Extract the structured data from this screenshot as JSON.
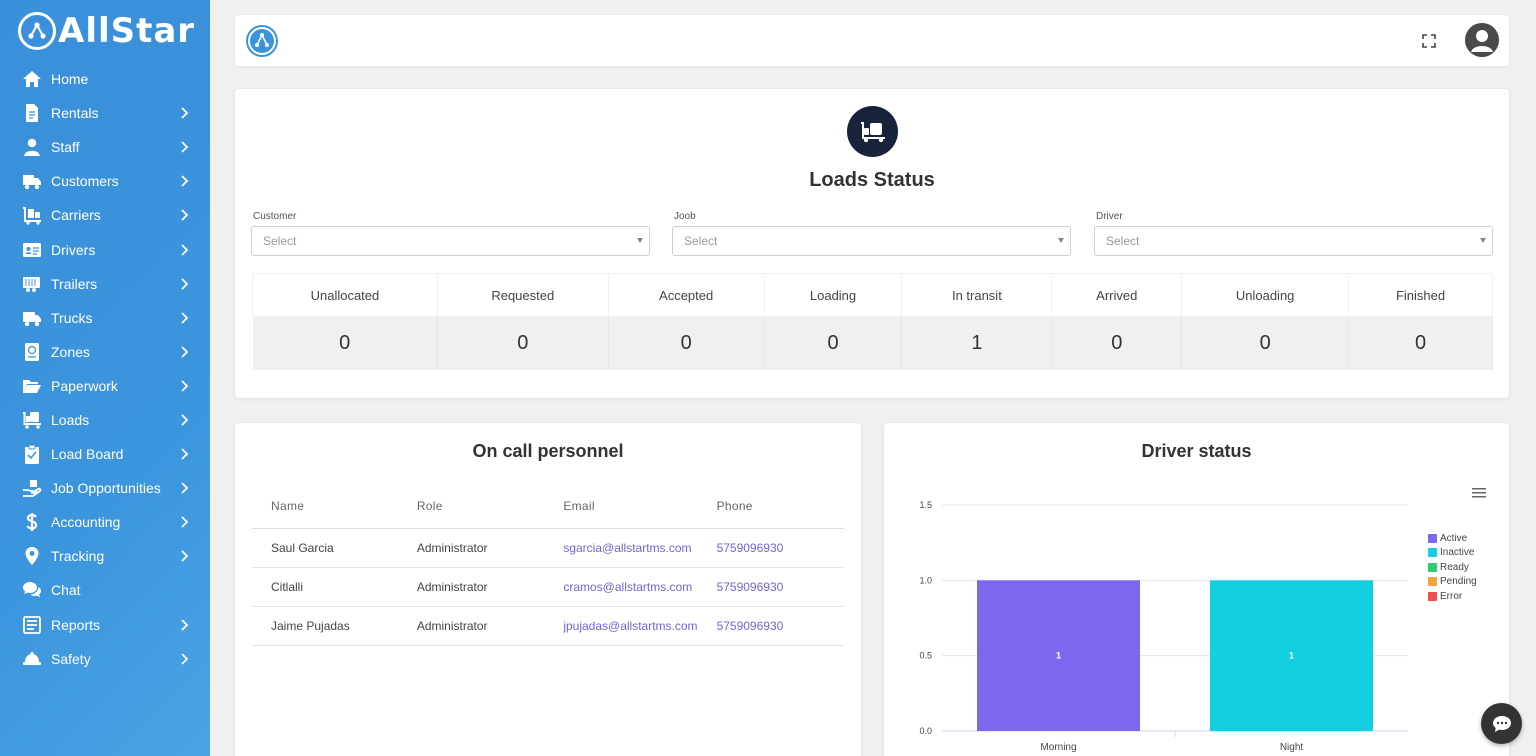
{
  "brand": {
    "name": "AllStar"
  },
  "sidebar": {
    "items": [
      {
        "label": "Home",
        "icon": "home-icon",
        "has_submenu": false
      },
      {
        "label": "Rentals",
        "icon": "file-icon",
        "has_submenu": true
      },
      {
        "label": "Staff",
        "icon": "user-icon",
        "has_submenu": true
      },
      {
        "label": "Customers",
        "icon": "truck-moving-icon",
        "has_submenu": true
      },
      {
        "label": "Carriers",
        "icon": "dolly-icon",
        "has_submenu": true
      },
      {
        "label": "Drivers",
        "icon": "id-card-icon",
        "has_submenu": true
      },
      {
        "label": "Trailers",
        "icon": "trailer-icon",
        "has_submenu": true
      },
      {
        "label": "Trucks",
        "icon": "truck-icon",
        "has_submenu": true
      },
      {
        "label": "Zones",
        "icon": "passport-icon",
        "has_submenu": true
      },
      {
        "label": "Paperwork",
        "icon": "folder-open-icon",
        "has_submenu": true
      },
      {
        "label": "Loads",
        "icon": "loads-icon",
        "has_submenu": true
      },
      {
        "label": "Load Board",
        "icon": "clipboard-icon",
        "has_submenu": true
      },
      {
        "label": "Job Opportunities",
        "icon": "hand-holding-icon",
        "has_submenu": true
      },
      {
        "label": "Accounting",
        "icon": "dollar-icon",
        "has_submenu": true
      },
      {
        "label": "Tracking",
        "icon": "map-marker-icon",
        "has_submenu": true
      },
      {
        "label": "Chat",
        "icon": "comments-icon",
        "has_submenu": false
      },
      {
        "label": "Reports",
        "icon": "list-alt-icon",
        "has_submenu": true
      },
      {
        "label": "Safety",
        "icon": "hard-hat-icon",
        "has_submenu": true
      }
    ]
  },
  "loads_status": {
    "title": "Loads Status",
    "filters": [
      {
        "label": "Customer",
        "placeholder": "Select"
      },
      {
        "label": "Joob",
        "placeholder": "Select"
      },
      {
        "label": "Driver",
        "placeholder": "Select"
      }
    ],
    "columns": [
      "Unallocated",
      "Requested",
      "Accepted",
      "Loading",
      "In transit",
      "Arrived",
      "Unloading",
      "Finished"
    ],
    "counts": [
      "0",
      "0",
      "0",
      "0",
      "1",
      "0",
      "0",
      "0"
    ]
  },
  "on_call": {
    "title": "On call personnel",
    "headers": [
      "Name",
      "Role",
      "Email",
      "Phone"
    ],
    "rows": [
      {
        "name": "Saul Garcia",
        "role": "Administrator",
        "email": "sgarcia@allstartms.com",
        "phone": "5759096930"
      },
      {
        "name": "Citlalli",
        "role": "Administrator",
        "email": "cramos@allstartms.com",
        "phone": "5759096930"
      },
      {
        "name": "Jaime Pujadas",
        "role": "Administrator",
        "email": "jpujadas@allstartms.com",
        "phone": "5759096930"
      }
    ]
  },
  "driver_status": {
    "title": "Driver status",
    "legend": [
      {
        "name": "Active",
        "color": "#7b68ee"
      },
      {
        "name": "Inactive",
        "color": "#13cfe0"
      },
      {
        "name": "Ready",
        "color": "#2ecc71"
      },
      {
        "name": "Pending",
        "color": "#f5a142"
      },
      {
        "name": "Error",
        "color": "#ee4e4e"
      }
    ]
  },
  "chart_data": {
    "type": "bar",
    "title": "Driver status",
    "categories": [
      "Morning",
      "Night"
    ],
    "series": [
      {
        "name": "Active",
        "values": [
          1,
          0
        ]
      },
      {
        "name": "Inactive",
        "values": [
          0,
          1
        ]
      },
      {
        "name": "Ready",
        "values": [
          0,
          0
        ]
      },
      {
        "name": "Pending",
        "values": [
          0,
          0
        ]
      },
      {
        "name": "Error",
        "values": [
          0,
          0
        ]
      }
    ],
    "yticks": [
      "0.0",
      "0.5",
      "1.0",
      "1.5"
    ],
    "ylim": [
      0,
      1.5
    ],
    "grid": true,
    "legend_position": "right",
    "data_labels": true
  }
}
